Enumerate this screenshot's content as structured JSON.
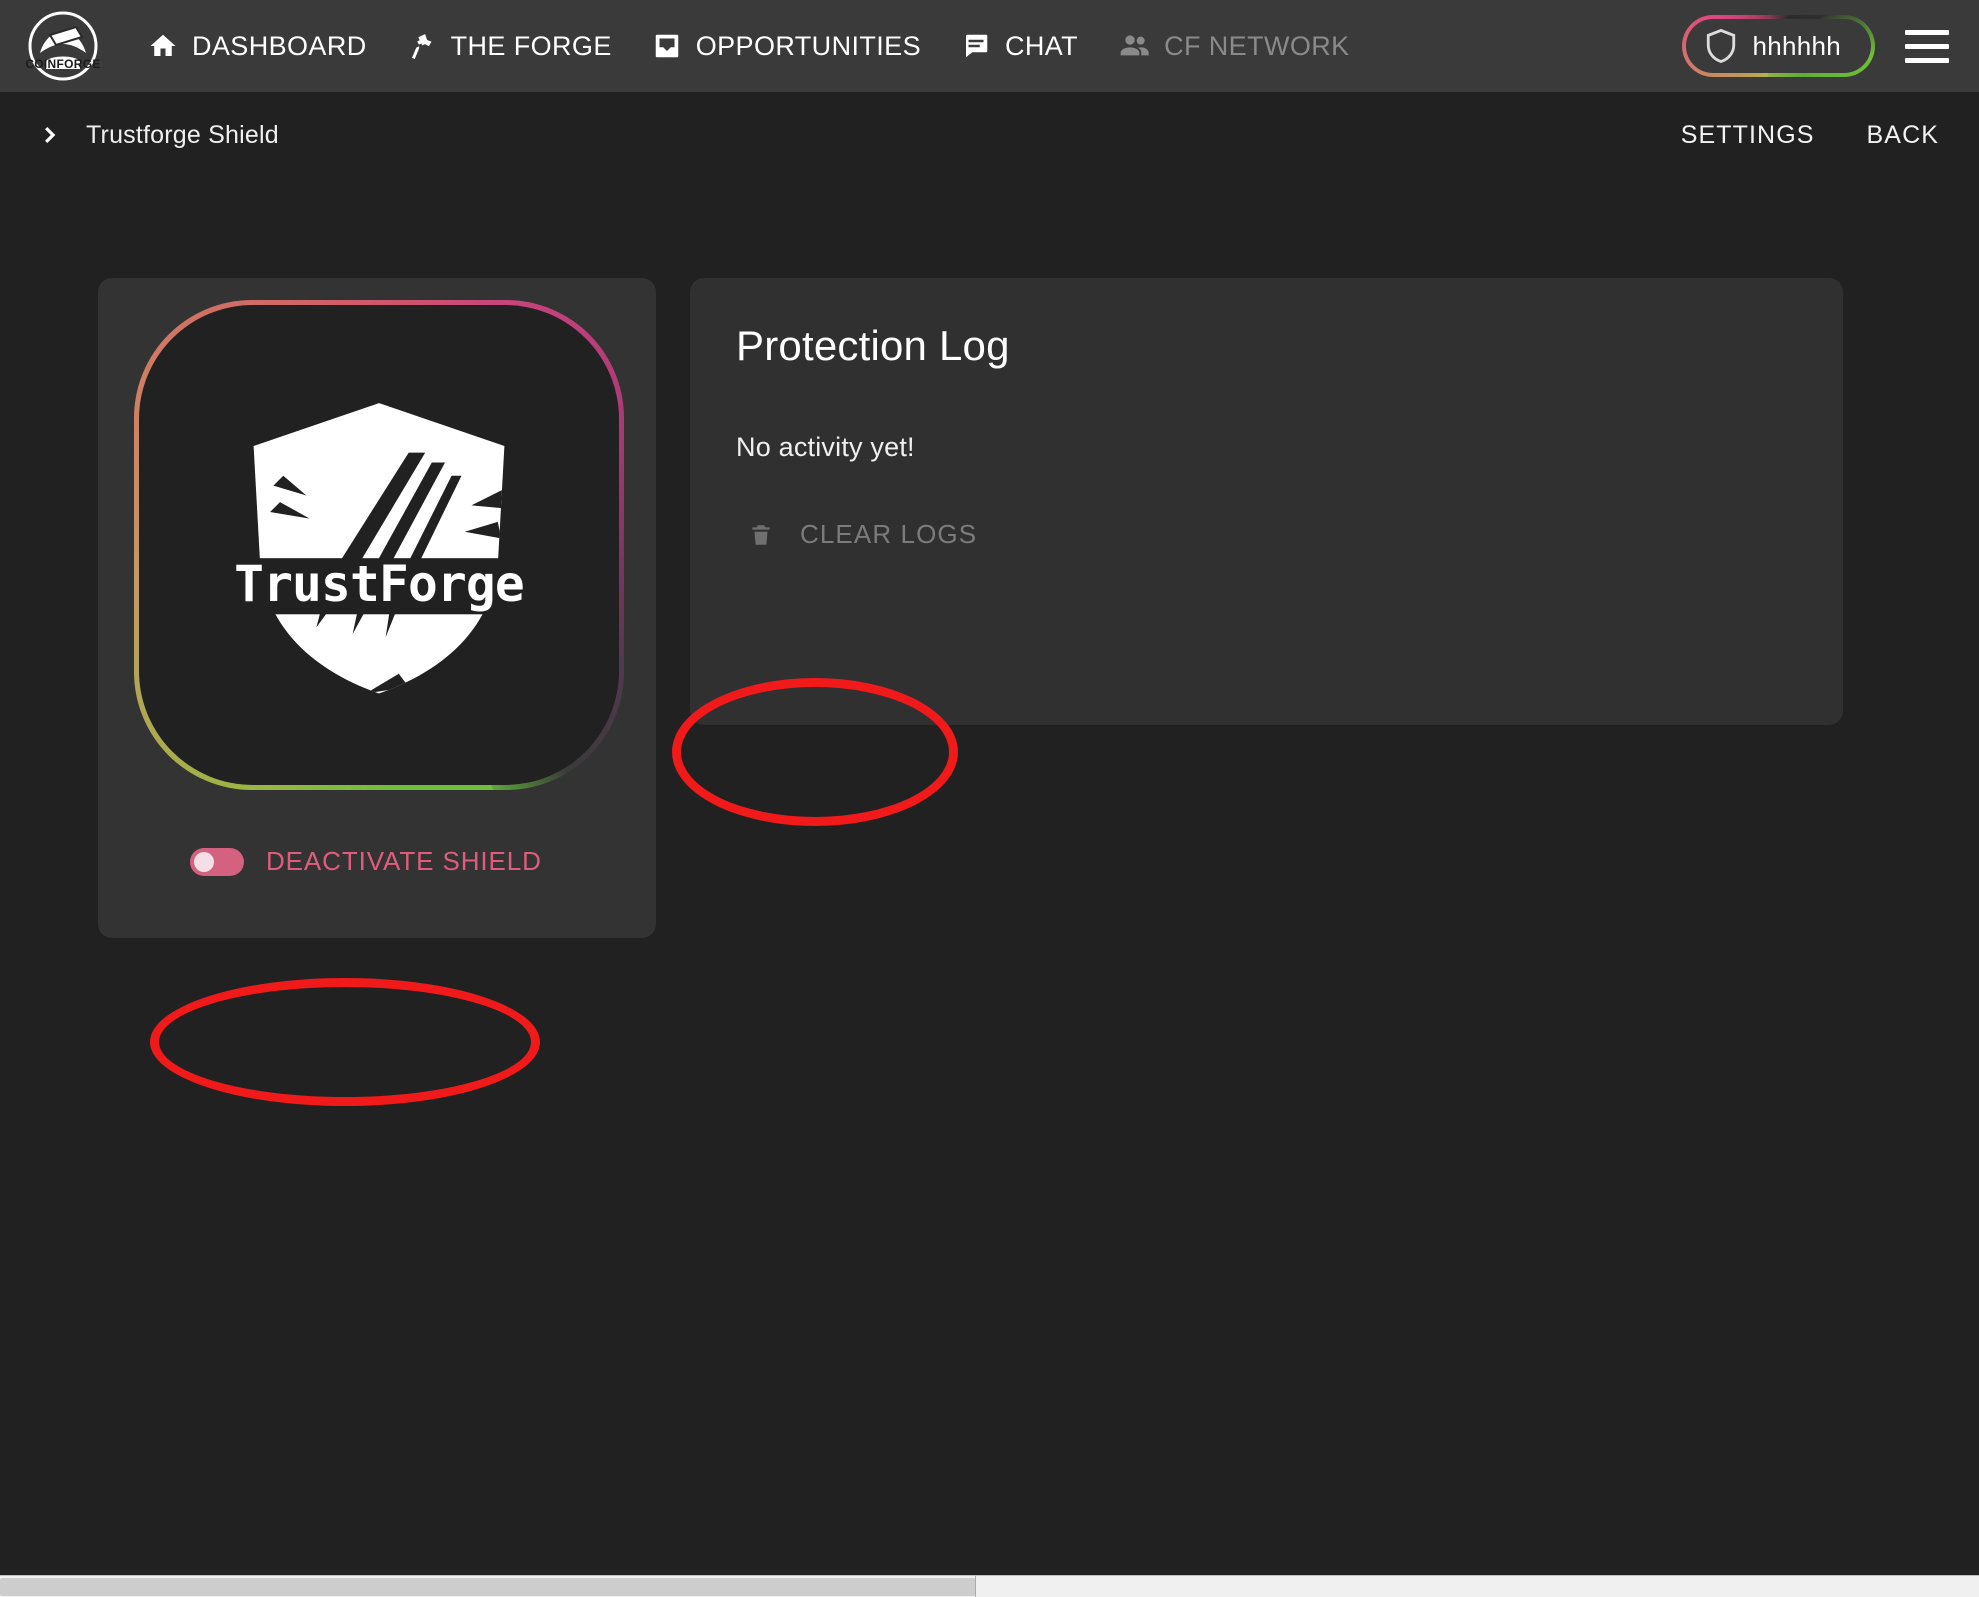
{
  "app": {
    "brand_name": "COINFORGE",
    "logo_icon": "coinforge-anvil-logo"
  },
  "topnav": {
    "items": [
      {
        "label": "DASHBOARD",
        "icon": "home-icon",
        "disabled": false
      },
      {
        "label": "THE FORGE",
        "icon": "hammer-icon",
        "disabled": false
      },
      {
        "label": "OPPORTUNITIES",
        "icon": "inbox-icon",
        "disabled": false
      },
      {
        "label": "CHAT",
        "icon": "chat-bubble-icon",
        "disabled": false
      },
      {
        "label": "CF NETWORK",
        "icon": "people-icon",
        "disabled": true
      }
    ],
    "user": {
      "name": "hhhhhh",
      "icon": "shield-icon",
      "ring_colors": [
        "#6fbf3a",
        "#b0b54a",
        "#c98b62",
        "#e0467f"
      ]
    },
    "menu_icon": "hamburger-menu-icon"
  },
  "breadcrumb": {
    "arrow_icon": "chevron-right-icon",
    "text": "Trustforge Shield",
    "settings_label": "SETTINGS",
    "back_label": "BACK"
  },
  "shield_card": {
    "logo_icon": "trustforge-shield-logo",
    "logo_wordmark": "TrustForge",
    "toggle": {
      "label": "DEACTIVATE SHIELD",
      "state": "off",
      "color": "#e05c7e"
    }
  },
  "protection_log": {
    "title": "Protection Log",
    "empty_message": "No activity yet!",
    "clear_button": {
      "label": "CLEAR LOGS",
      "icon": "trash-icon",
      "disabled": true
    }
  },
  "annotations": {
    "color": "#f11a1a",
    "shapes": [
      {
        "name": "clear-logs-highlight",
        "target": "CLEAR LOGS"
      },
      {
        "name": "deactivate-shield-highlight",
        "target": "DEACTIVATE SHIELD"
      }
    ]
  },
  "colors": {
    "page_bg": "#212121",
    "topbar_bg": "#3a3a3a",
    "card_bg": "#333333",
    "panel_bg": "#303030",
    "text_primary": "#ffffff",
    "text_muted": "#8a8a8a",
    "accent_red": "#f11a1a"
  }
}
